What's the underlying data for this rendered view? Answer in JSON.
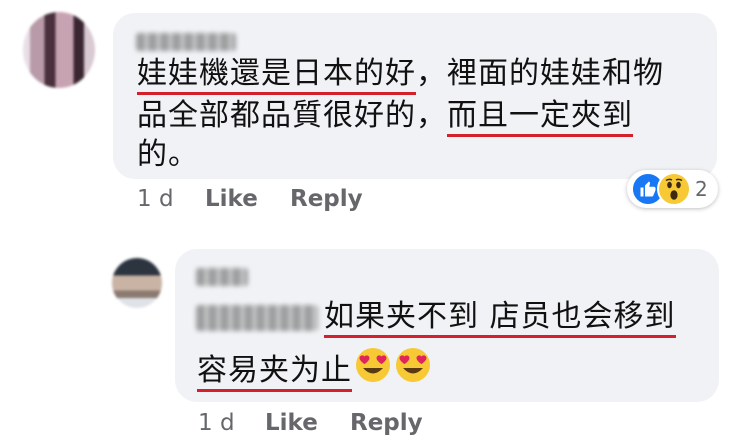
{
  "comment1": {
    "text_line1_part1": "娃娃機還是日本的好",
    "text_line1_part2": "，裡面的娃娃和物",
    "text_line2_part1": "品全部都品質很好的，",
    "text_line2_part2": "而且一定夾到",
    "text_line3": "的。",
    "time": "1 d",
    "like_label": "Like",
    "reply_label": "Reply",
    "reaction_count": "2",
    "reaction_icons": [
      "like-icon",
      "wow-icon"
    ]
  },
  "comment2": {
    "text_line1": "如果夹不到 店员也会移到",
    "text_line2": "容易夹为止",
    "emojis": [
      "heart-eyes-emoji",
      "heart-eyes-emoji"
    ],
    "time": "1 d",
    "like_label": "Like",
    "reply_label": "Reply"
  },
  "colors": {
    "bubble": "#f0f2f5",
    "underline": "#d3202a",
    "meta": "#65676b",
    "like_blue": "#1877f2"
  }
}
